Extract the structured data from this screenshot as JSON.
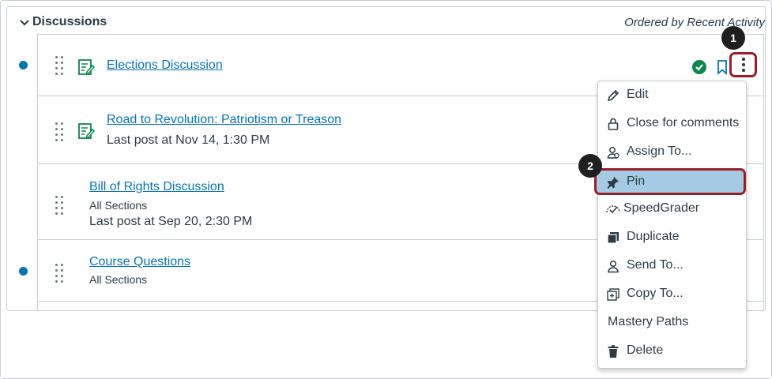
{
  "header": {
    "title": "Discussions",
    "ordered_by": "Ordered by Recent Activity"
  },
  "discussions": [
    {
      "title": "Elections Discussion",
      "unread": true
    },
    {
      "title": "Road to Revolution: Patriotism or Treason",
      "last_post": "Last post at Nov 14, 1:30 PM",
      "unread": false
    },
    {
      "title": "Bill of Rights Discussion",
      "sections": "All Sections",
      "last_post": "Last post at Sep 20, 2:30 PM",
      "unread": false
    },
    {
      "title": "Course Questions",
      "sections": "All Sections",
      "unread": true
    }
  ],
  "menu": {
    "items": [
      {
        "label": "Edit",
        "icon": "pencil-icon"
      },
      {
        "label": "Close for comments",
        "icon": "lock-icon"
      },
      {
        "label": "Assign To...",
        "icon": "assign-user-icon"
      },
      {
        "label": "Pin",
        "icon": "pin-icon",
        "highlighted": true
      },
      {
        "label": "SpeedGrader",
        "icon": "speedgrader-icon"
      },
      {
        "label": "Duplicate",
        "icon": "duplicate-icon"
      },
      {
        "label": "Send To...",
        "icon": "send-user-icon"
      },
      {
        "label": "Copy To...",
        "icon": "copy-icon"
      },
      {
        "label": "Mastery Paths",
        "icon": ""
      },
      {
        "label": "Delete",
        "icon": "trash-icon"
      }
    ]
  },
  "callouts": [
    "1",
    "2"
  ],
  "colors": {
    "link": "#0374b5",
    "published": "#0b874b",
    "highlight_border": "#9b1d27",
    "pin_highlight": "#a4cbe3",
    "assignment_icon": "#0b874b"
  }
}
